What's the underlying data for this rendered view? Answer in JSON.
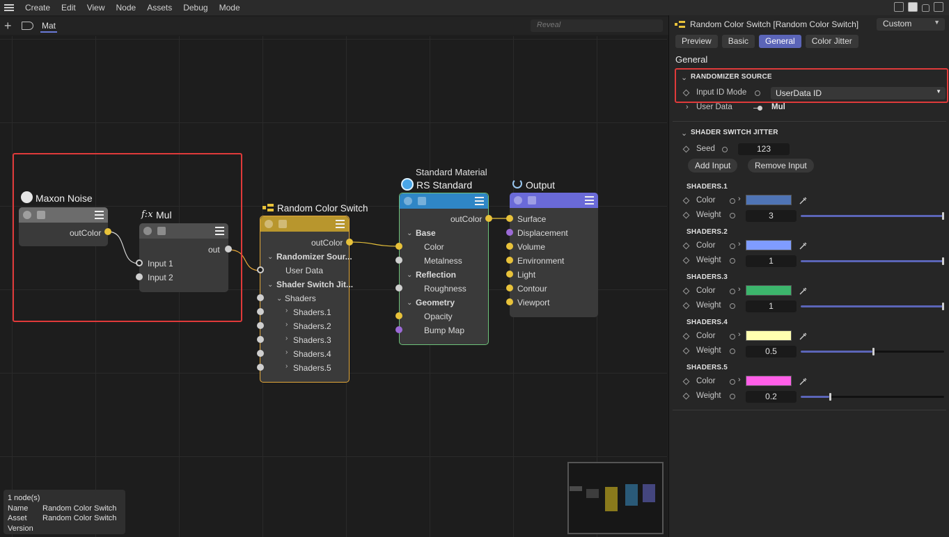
{
  "menubar": {
    "items": [
      "Create",
      "Edit",
      "View",
      "Node",
      "Assets",
      "Debug",
      "Mode"
    ]
  },
  "toolbar": {
    "tab_label": "Mat",
    "reveal_placeholder": "Reveal"
  },
  "canvas": {
    "nodes": {
      "maxon_noise": {
        "title": "Maxon Noise",
        "out_port": "outColor"
      },
      "mul": {
        "title": "Mul",
        "title_icon": "f:x",
        "out_port": "out",
        "inputs": [
          "Input 1",
          "Input 2"
        ]
      },
      "random_color_switch": {
        "title": "Random Color Switch",
        "out_port": "outColor",
        "rows": [
          "Randomizer Sour...",
          "User Data",
          "Shader Switch Jit...",
          "Shaders",
          "Shaders.1",
          "Shaders.2",
          "Shaders.3",
          "Shaders.4",
          "Shaders.5"
        ]
      },
      "rs_standard": {
        "subtitle": "Standard Material",
        "title": "RS Standard",
        "out_port": "outColor",
        "rows": [
          "Base",
          "Color",
          "Metalness",
          "Reflection",
          "Roughness",
          "Geometry",
          "Opacity",
          "Bump Map"
        ]
      },
      "output": {
        "title": "Output",
        "rows": [
          "Surface",
          "Displacement",
          "Volume",
          "Environment",
          "Light",
          "Contour",
          "Viewport"
        ]
      }
    },
    "info": {
      "count": "1 node(s)",
      "name_label": "Name",
      "name_value": "Random Color Switch",
      "asset_label": "Asset",
      "asset_value": "Random Color Switch",
      "version_label": "Version"
    }
  },
  "panel": {
    "title": "Random Color Switch [Random Color Switch]",
    "preset": "Custom",
    "tabs": [
      "Preview",
      "Basic",
      "General",
      "Color Jitter"
    ],
    "active_tab": "General",
    "section_title": "General",
    "randomizer": {
      "header": "RANDOMIZER SOURCE",
      "input_id_mode_label": "Input ID Mode",
      "input_id_mode_value": "UserData ID",
      "user_data_label": "User Data",
      "user_data_value": "Mul"
    },
    "jitter": {
      "header": "SHADER SWITCH JITTER",
      "seed_label": "Seed",
      "seed_value": "123",
      "add_input": "Add Input",
      "remove_input": "Remove Input"
    },
    "shaders": [
      {
        "header": "SHADERS.1",
        "color_label": "Color",
        "weight_label": "Weight",
        "color": "#4f74b5",
        "weight": "3",
        "weight_fraction": 1.0
      },
      {
        "header": "SHADERS.2",
        "color_label": "Color",
        "weight_label": "Weight",
        "color": "#7f9cff",
        "weight": "1",
        "weight_fraction": 1.0
      },
      {
        "header": "SHADERS.3",
        "color_label": "Color",
        "weight_label": "Weight",
        "color": "#3cb56c",
        "weight": "1",
        "weight_fraction": 1.0
      },
      {
        "header": "SHADERS.4",
        "color_label": "Color",
        "weight_label": "Weight",
        "color": "#ffffb0",
        "weight": "0.5",
        "weight_fraction": 0.5
      },
      {
        "header": "SHADERS.5",
        "color_label": "Color",
        "weight_label": "Weight",
        "color": "#ff5fe8",
        "weight": "0.2",
        "weight_fraction": 0.2
      }
    ]
  },
  "colors": {
    "accent": "#5b65b8",
    "selection": "#e03a3a",
    "port_yellow": "#e8c23a",
    "port_purple": "#9b6ad6"
  }
}
